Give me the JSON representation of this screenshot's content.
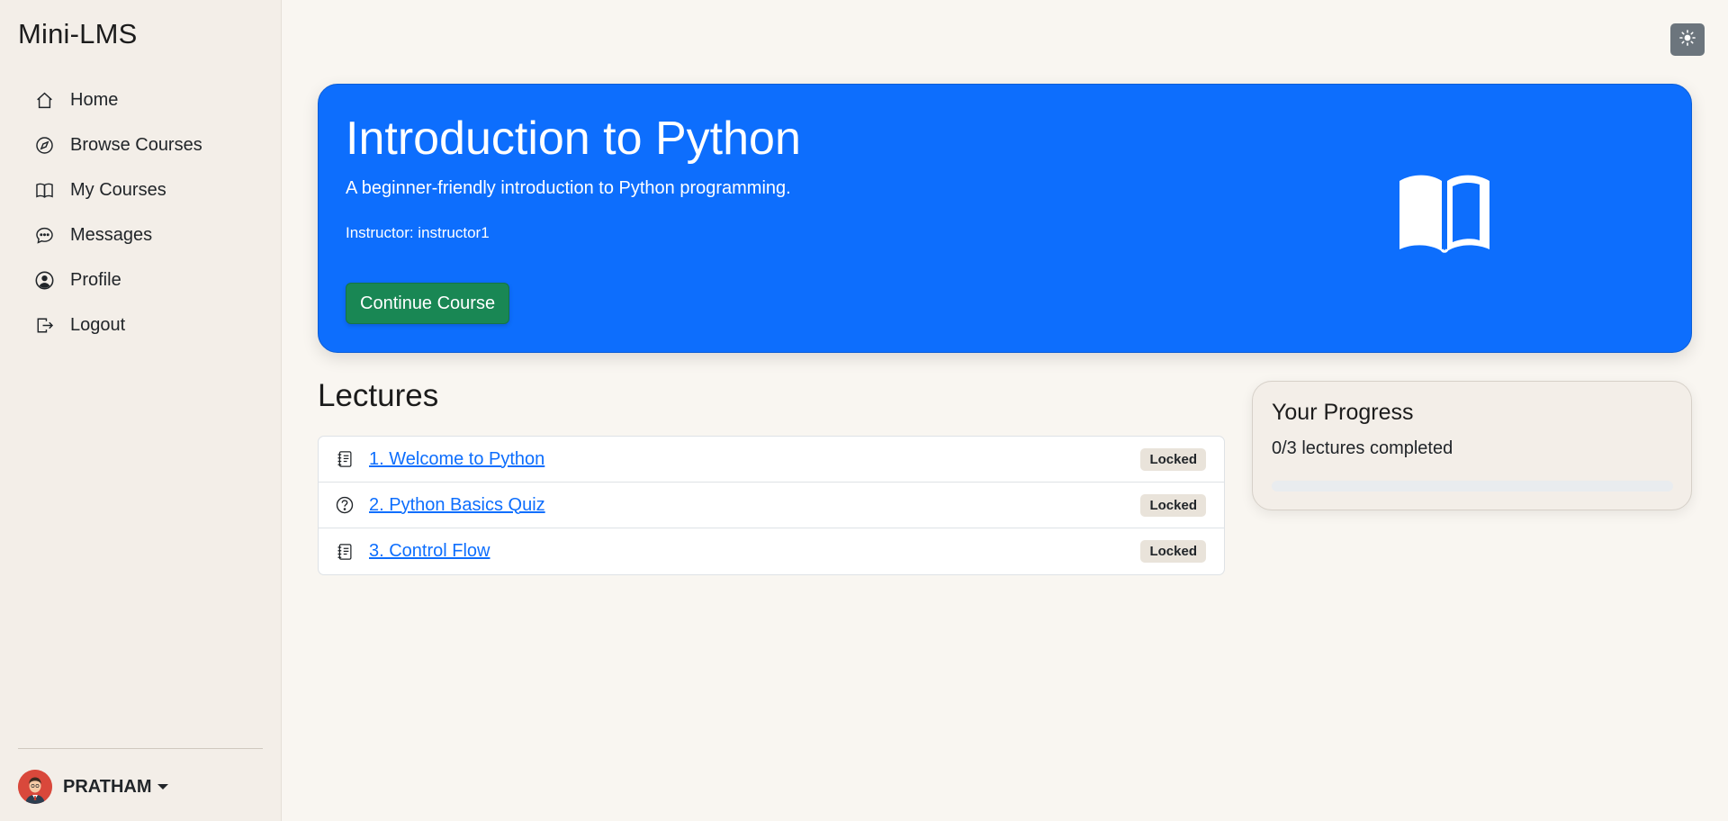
{
  "app": {
    "brand": "Mini-LMS",
    "theme_icon": "sun-icon"
  },
  "sidebar": {
    "items": [
      {
        "label": "Home",
        "icon": "house-icon"
      },
      {
        "label": "Browse Courses",
        "icon": "compass-icon"
      },
      {
        "label": "My Courses",
        "icon": "book-icon"
      },
      {
        "label": "Messages",
        "icon": "chat-dots-icon"
      },
      {
        "label": "Profile",
        "icon": "person-circle-icon"
      },
      {
        "label": "Logout",
        "icon": "box-arrow-right-icon"
      }
    ],
    "user": {
      "name": "PRATHAM"
    }
  },
  "course": {
    "title": "Introduction to Python",
    "description": "A beginner-friendly introduction to Python programming.",
    "instructor": "Instructor: instructor1",
    "continue_label": "Continue Course",
    "banner_icon": "open-book-icon"
  },
  "lectures": {
    "heading": "Lectures",
    "items": [
      {
        "title": "1. Welcome to Python",
        "icon": "journal-text-icon",
        "status": "Locked"
      },
      {
        "title": "2. Python Basics Quiz",
        "icon": "question-circle-icon",
        "status": "Locked"
      },
      {
        "title": "3. Control Flow",
        "icon": "journal-text-icon",
        "status": "Locked"
      }
    ]
  },
  "progress": {
    "heading": "Your Progress",
    "summary": "0/3 lectures completed",
    "fraction": 0
  },
  "colors": {
    "primary": "#0d6efd",
    "success": "#198754",
    "sidebar_bg": "#f3eee8",
    "page_bg": "#f9f6f1"
  }
}
